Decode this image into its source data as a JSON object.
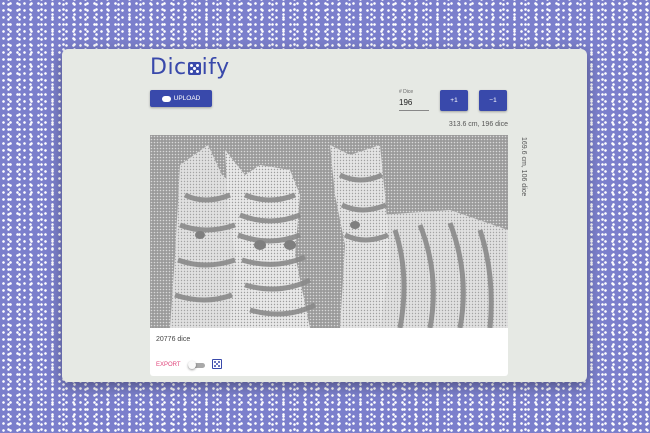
{
  "app": {
    "logo_text_pre": "Dic",
    "logo_text_post": "ify"
  },
  "toolbar": {
    "upload_label": "UPLOAD",
    "upload_icon": "cloud-upload-icon",
    "dice_field_label": "# Dice",
    "dice_field_value": "196",
    "plus_label": "+1",
    "minus_label": "−1"
  },
  "dimensions": {
    "horizontal": "313.6 cm, 196 dice",
    "vertical": "169.6 cm, 106 dice"
  },
  "image": {
    "subject": "zebras"
  },
  "footer": {
    "dice_count": "20776 dice",
    "export_label": "EXPORT",
    "toggle_on": false,
    "die_icon": "die-icon"
  },
  "colors": {
    "accent": "#3949ab",
    "background": "#7b7fcc",
    "export": "#e0457b"
  }
}
